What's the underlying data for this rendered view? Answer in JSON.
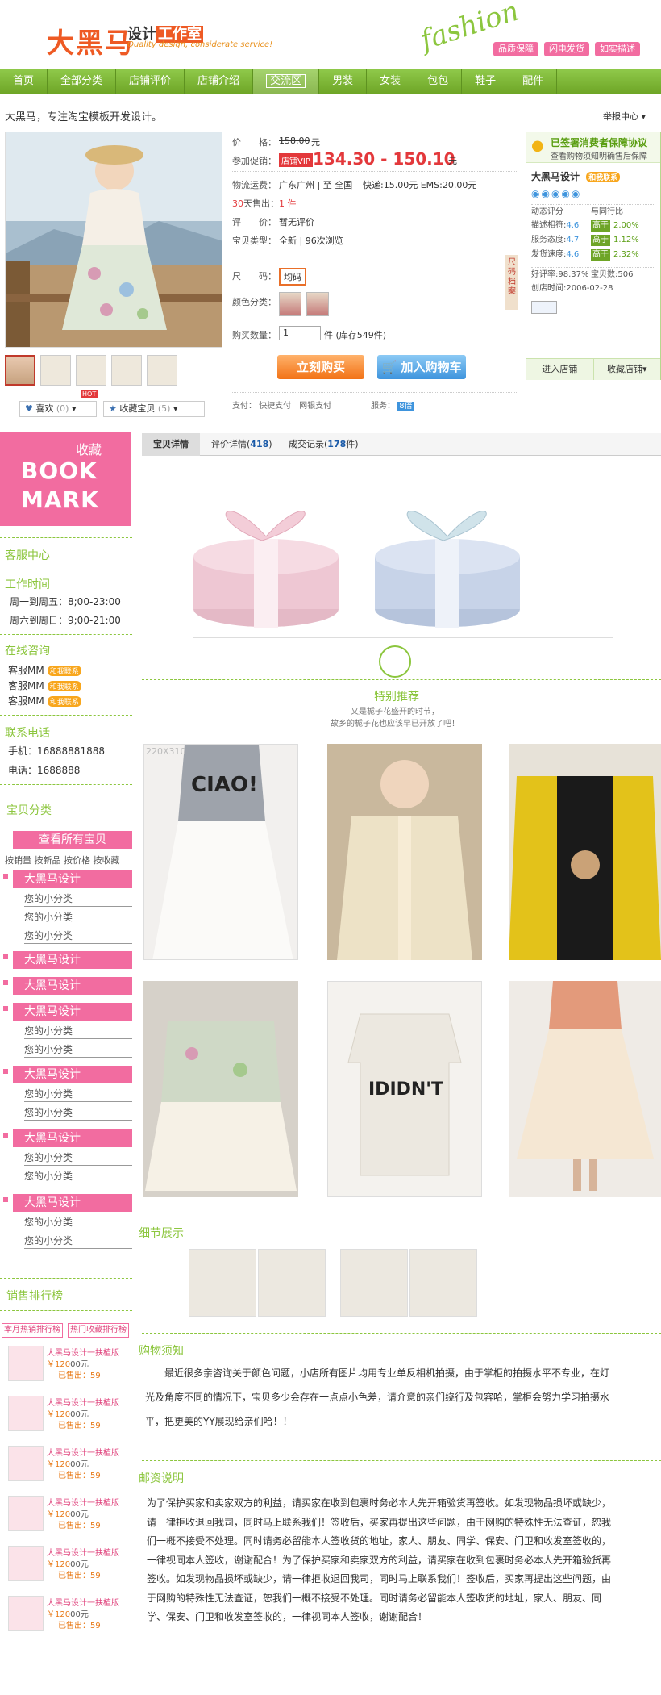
{
  "header": {
    "logo": "大黑马",
    "logo_sub_1": "设计",
    "logo_sub_2": "工作室",
    "tagline": "Quality design, considerate service!",
    "fashion": "fashion",
    "badges": [
      "品质保障",
      "闪电发货",
      "如实描述"
    ]
  },
  "nav": {
    "items": [
      "首页",
      "全部分类",
      "店铺评价",
      "店铺介绍",
      "交流区",
      "男装",
      "女装",
      "包包",
      "鞋子",
      "配件"
    ],
    "active_index": 4
  },
  "shop_strip": {
    "title": "大黑马，专注淘宝模板开发设计。",
    "report": "举报中心"
  },
  "product": {
    "price_label": "价　　格：",
    "old_price": "158.00",
    "unit": "元",
    "promo_label": "参加促销：",
    "vip": "店铺VIP",
    "new_price": "134.30 - 150.10",
    "ship_label": "物流运费：",
    "ship_from": "广东广州 | 至 全国",
    "ship_fee": "快递:15.00元 EMS:20.00元",
    "sold_label": "天售出：",
    "sold_prefix": "30",
    "sold_value": "1 件",
    "review_label": "评　　价：",
    "review_value": "暂无评价",
    "type_label": "宝贝类型：",
    "type_value": "全新 | 96次浏览",
    "size_label": "尺　　码：",
    "size_value": "均码",
    "color_label": "颜色分类：",
    "qty_label": "购买数量：",
    "qty_value": "1",
    "stock": "件 (库存549件)",
    "buy_label": "立刻购买",
    "cart_label": "加入购物车",
    "pay_label": "支付：",
    "pay_value": "快捷支付　网银支付",
    "service_label": "服务：",
    "service_value": "8倍",
    "side_tab": "尺码档案",
    "like_label": "喜欢",
    "like_count": "(0)",
    "fav_label": "收藏宝贝",
    "fav_count": "(5)",
    "hot": "HOT"
  },
  "shop_card": {
    "head_title": "已签署消费者保障协议",
    "head_sub": "查看购物须知明确售后保障",
    "name": "大黑马设计",
    "talk": "和我联系",
    "dyn_label": "动态评分",
    "compare_label": "与同行比",
    "rows": [
      {
        "k": "描述相符:",
        "v": "4.6",
        "cmp": "高于",
        "pct": "2.00%"
      },
      {
        "k": "服务态度:",
        "v": "4.7",
        "cmp": "高于",
        "pct": "1.12%"
      },
      {
        "k": "发货速度:",
        "v": "4.6",
        "cmp": "高于",
        "pct": "2.32%"
      }
    ],
    "good_rate": "好评率:98.37%",
    "total": "宝贝数:506",
    "created": "创店时间:2006-02-28",
    "enter": "进入店铺",
    "favshop": "收藏店铺"
  },
  "left": {
    "bookmark_cn": "收藏",
    "bookmark_en_1": "BOOK",
    "bookmark_en_2": "MARK",
    "service_title": "客服中心",
    "hours_title": "工作时间",
    "hours_1": "周一到周五：8;00-23:00",
    "hours_2": "周六到周日：9;00-21:00",
    "online_title": "在线咨询",
    "agents": [
      "客服MM",
      "客服MM",
      "客服MM"
    ],
    "talk": "和我联系",
    "phone_title": "联系电话",
    "mobile": "手机：16888881888",
    "tel": "电话：1688888",
    "category_title": "宝贝分类",
    "view_all": "查看所有宝贝",
    "sort_row": "按销量 按新品 按价格 按收藏",
    "cat_main": "大黑马设计",
    "cat_sub": "您的小分类",
    "rank_title": "销售排行榜",
    "rank_tab_1": "本月热销排行榜",
    "rank_tab_2": "热门收藏排行榜",
    "rank_item_title": "大黑马设计一扶植版",
    "rank_price": "￥120",
    "rank_price_unit": "00元",
    "rank_sold": "已售出：59"
  },
  "main": {
    "tabs": [
      {
        "label": "宝贝详情",
        "num": ""
      },
      {
        "label": "评价详情",
        "num": "418"
      },
      {
        "label": "成交记录",
        "num": "178"
      }
    ],
    "tab_suffix": "件",
    "rec_title": "特别推荐",
    "rec_sub_1": "又是栀子花盛开的时节，",
    "rec_sub_2": "故乡的栀子花也应该早已开放了吧！",
    "img_size": "220X310",
    "detail_title": "细节展示",
    "notice_title": "购物须知",
    "notice_text": "　　最近很多亲咨询关于颜色问题，小店所有图片均用专业单反相机拍摄，由于掌柜的拍摄水平不专业，在灯光及角度不同的情况下，宝贝多少会存在一点点小色差，请介意的亲们绕行及包容哈，掌柜会努力学习拍摄水平，把更美的YY展现给亲们哈！！",
    "mail_title": "邮资说明",
    "mail_text": "为了保护买家和卖家双方的利益，请买家在收到包裹时务必本人先开箱验货再签收。如发现物品损坏或缺少，请一律拒收退回我司，同时马上联系我们！签收后，买家再提出这些问题，由于网购的特殊性无法查证，恕我们一概不接受不处理。同时请务必留能本人签收货的地址，家人、朋友、同学、保安、门卫和收发室签收的，一律视同本人签收，谢谢配合！为了保护买家和卖家双方的利益，请买家在收到包裹时务必本人先开箱验货再签收。如发现物品损坏或缺少，请一律拒收退回我司，同时马上联系我们！签收后，买家再提出这些问题，由于网购的特殊性无法查证，恕我们一概不接受不处理。同时请务必留能本人签收货的地址，家人、朋友、同学、保安、门卫和收发室签收的，一律视同本人签收，谢谢配合！",
    "shirt_text": "IDIDN'T",
    "ciao_text": "CIAO!"
  }
}
